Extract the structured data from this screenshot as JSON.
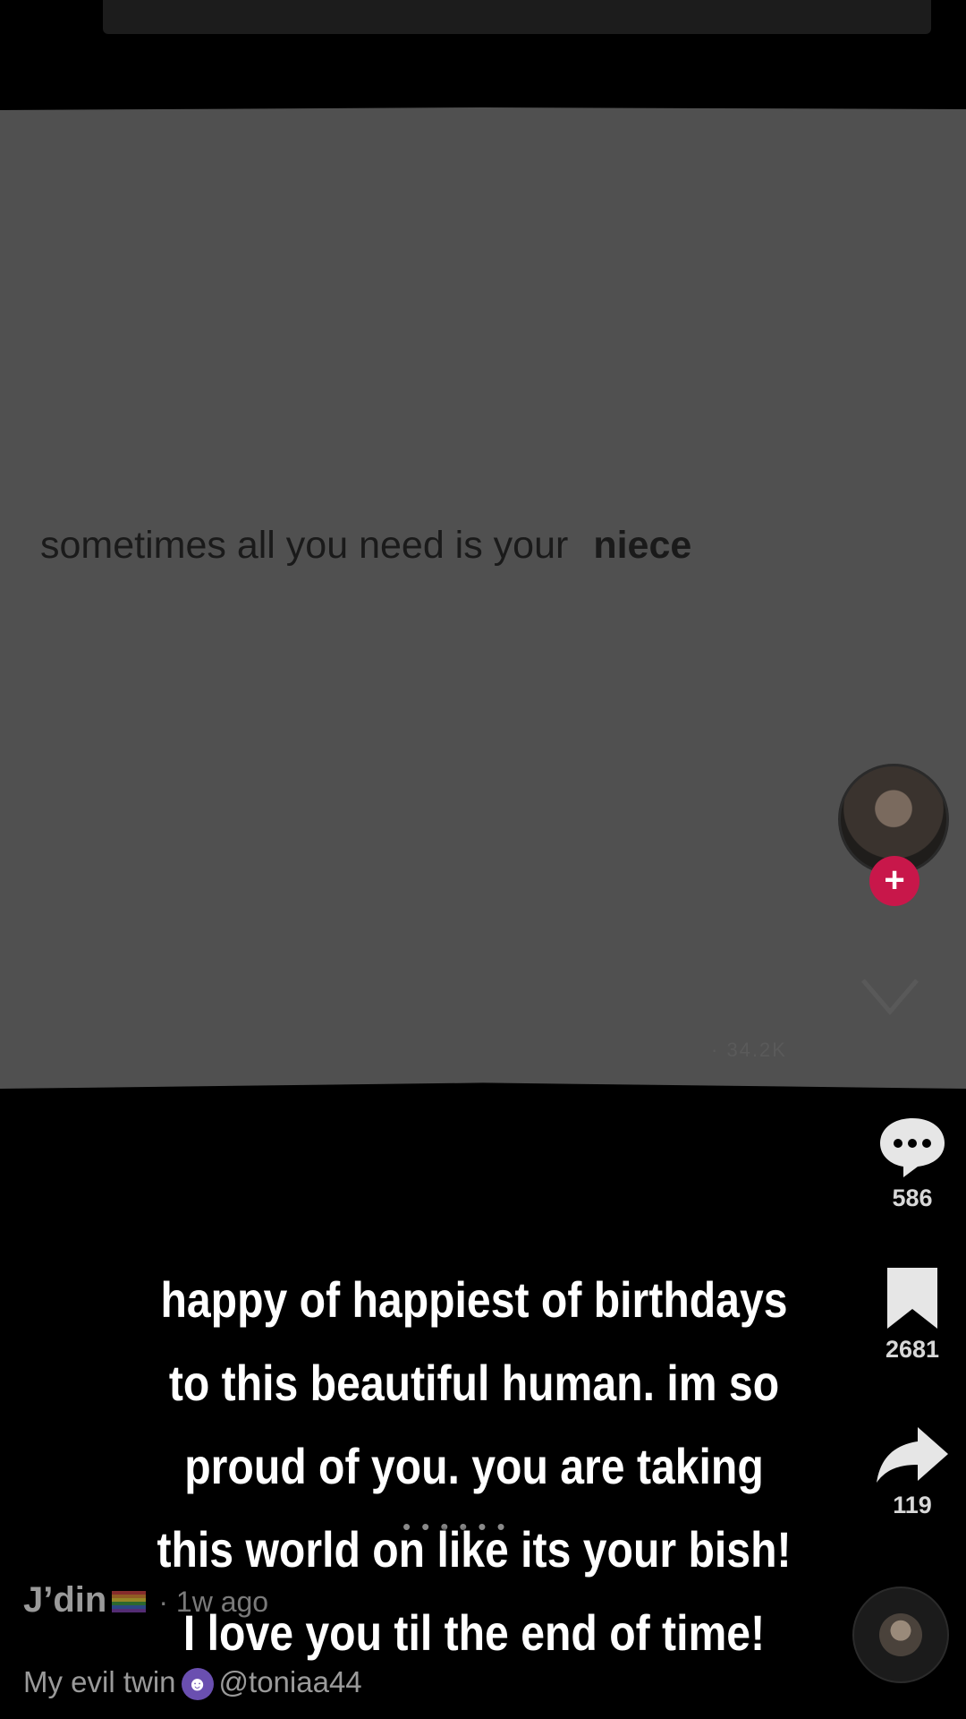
{
  "video": {
    "frame_caption_text": "sometimes all you need is your",
    "frame_caption_bold": "niece"
  },
  "overlay": {
    "text": "happy of happiest of birthdays to this beautiful human. im so proud of you. you are taking this world on like its your bish! I love you til the end of time!"
  },
  "sidebar": {
    "comments_count": "586",
    "bookmarks_count": "2681",
    "shares_count": "119",
    "ghost_counts": "· 34.2K"
  },
  "author": {
    "name": "J’din",
    "time_ago": "· 1w ago",
    "description_prefix": "My evil twin",
    "mention": "@toniaa44"
  },
  "icons": {
    "comment": "comment-bubble-icon",
    "bookmark": "bookmark-icon",
    "share": "share-arrow-icon",
    "follow": "plus-icon",
    "flag": "rainbow-flag-icon",
    "devil": "devil-emoji-icon"
  },
  "colors": {
    "follow_red": "#c8174a",
    "frame_gray": "#505050"
  }
}
